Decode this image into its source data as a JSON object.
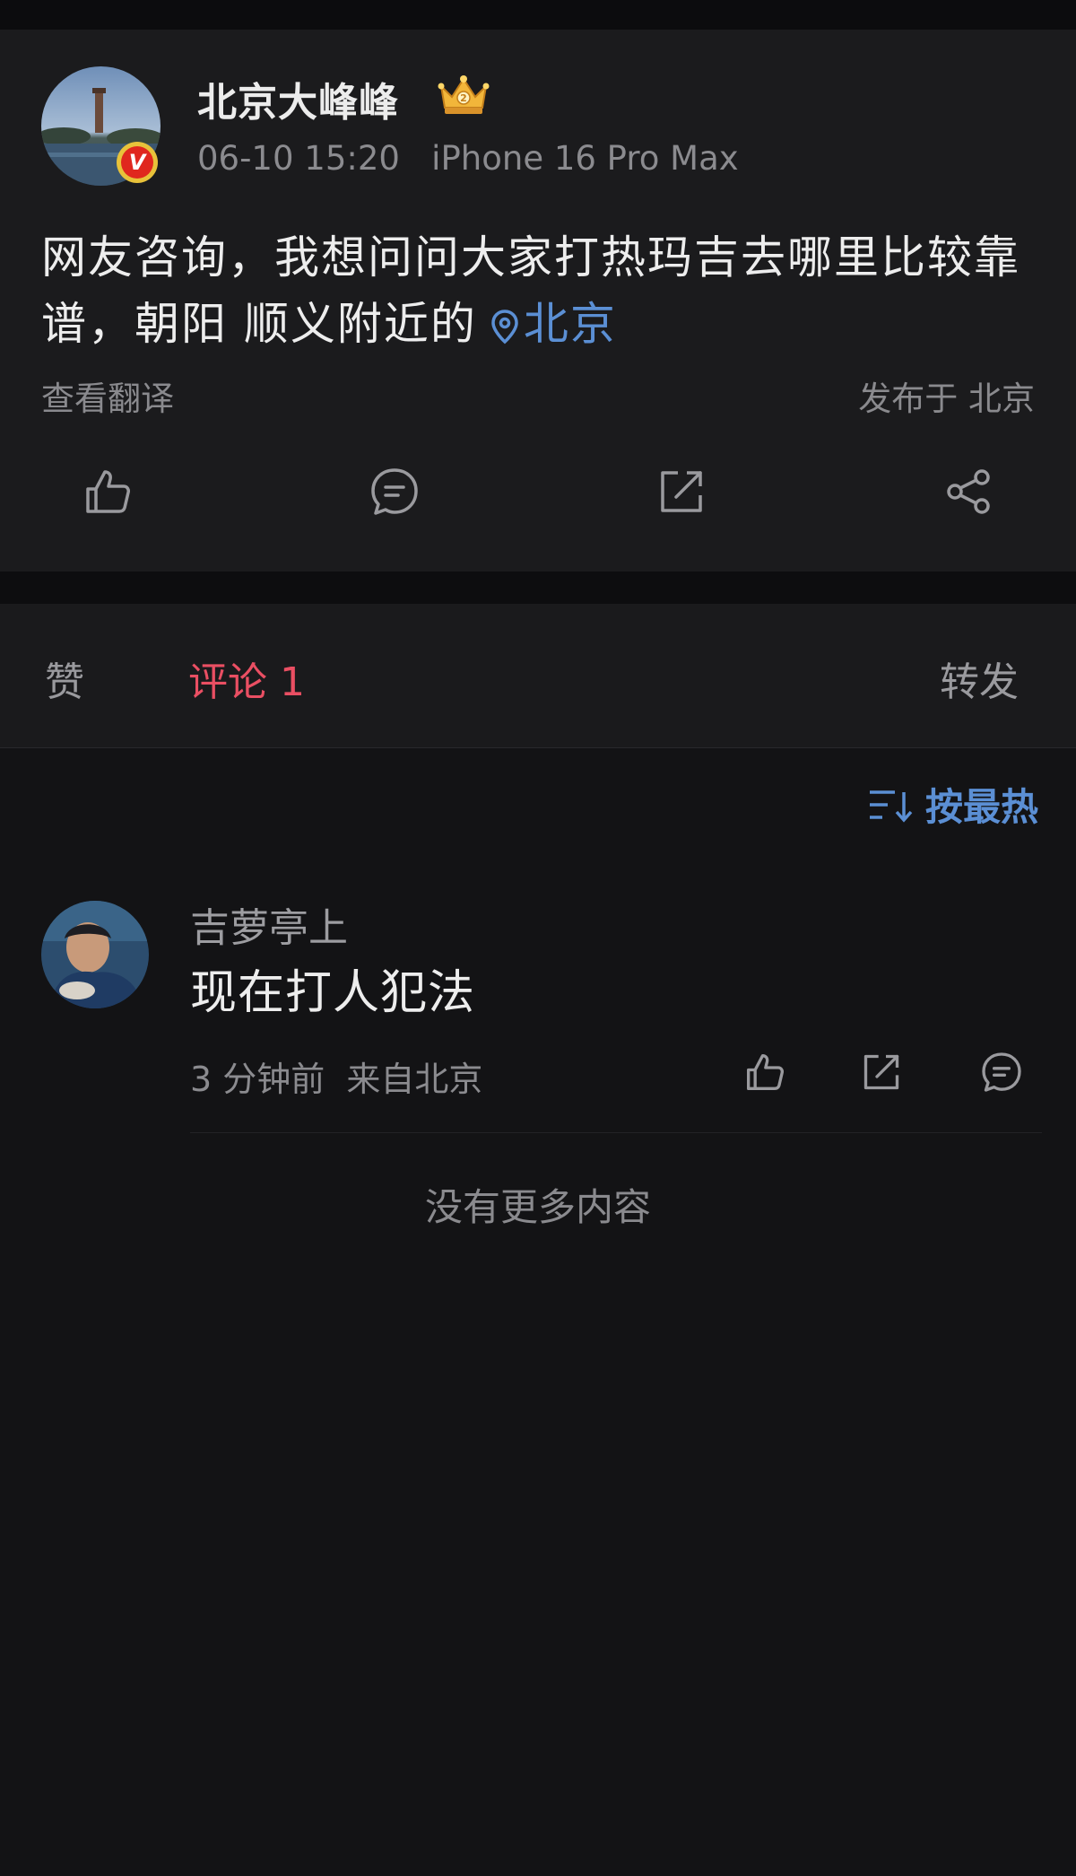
{
  "post": {
    "author": "北京大峰峰",
    "meta": "06-10 15:20   iPhone 16 Pro Max",
    "text": "网友咨询，我想问问大家打热玛吉去哪里比较靠谱，朝阳 顺义附近的",
    "location_link": "北京",
    "translate_label": "查看翻译",
    "published_from": "发布于 北京",
    "verify_badge": "V",
    "icons": [
      "like-icon",
      "comment-icon",
      "repost-icon",
      "share-icon",
      "crown-icon",
      "location-pin-icon"
    ]
  },
  "tabs": {
    "likes": "赞",
    "comments": "评论 1",
    "reposts": "转发"
  },
  "sort": {
    "label": "按最热",
    "icon": "sort-icon"
  },
  "comments": [
    {
      "author": "吉萝亭上",
      "text": "现在打人犯法",
      "meta": "3 分钟前  来自北京"
    }
  ],
  "footer": {
    "no_more": "没有更多内容"
  },
  "colors": {
    "background": "#131315",
    "card": "#1b1b1d",
    "accent_blue": "#5b8fd4",
    "accent_red": "#ea4f63",
    "verify_red": "#e0271e",
    "verify_gold": "#e8c23a"
  }
}
